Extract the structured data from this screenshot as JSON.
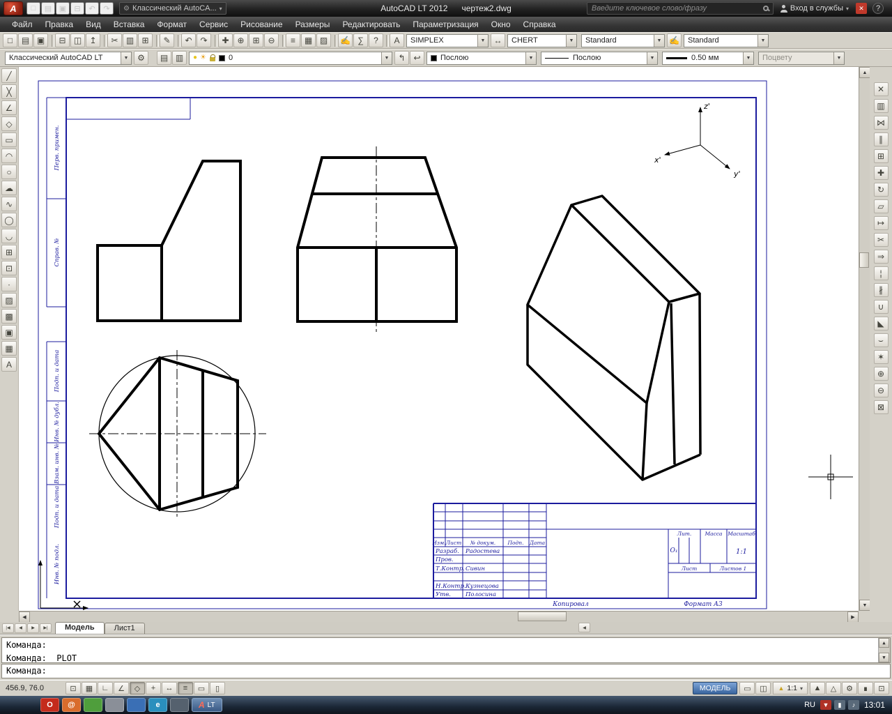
{
  "window": {
    "app_initial": "A",
    "title_app": "AutoCAD LT 2012",
    "title_doc": "чертеж2.dwg"
  },
  "colors": {
    "frame_blue": "#1b1b9e",
    "logo_red": "#a8250f",
    "model_button_blue": "#39659e",
    "drawing_black": "#000000"
  },
  "titlebar": {
    "workspace_combo": "Классический AutoCA...",
    "search_placeholder": "Введите ключевое слово/фразу",
    "signin_label": "Вход в службы",
    "help_label": "?"
  },
  "qat_icons": [
    {
      "name": "qat-new-icon",
      "glyph": "□"
    },
    {
      "name": "qat-open-icon",
      "glyph": "▤"
    },
    {
      "name": "qat-save-icon",
      "glyph": "▣"
    },
    {
      "name": "qat-plot-icon",
      "glyph": "⊟"
    },
    {
      "name": "qat-undo-icon",
      "glyph": "↶"
    },
    {
      "name": "qat-redo-icon",
      "glyph": "↷"
    }
  ],
  "menubar": {
    "items": [
      "Файл",
      "Правка",
      "Вид",
      "Вставка",
      "Формат",
      "Сервис",
      "Рисование",
      "Размеры",
      "Редактировать",
      "Параметризация",
      "Окно",
      "Справка"
    ]
  },
  "toolbar1_icons": [
    {
      "name": "new-button",
      "glyph": "□"
    },
    {
      "name": "open-button",
      "glyph": "▤"
    },
    {
      "name": "save-button",
      "glyph": "▣"
    },
    {
      "name": "plot-button",
      "glyph": "⊟",
      "gap": true
    },
    {
      "name": "plot-preview-button",
      "glyph": "◫"
    },
    {
      "name": "publish-button",
      "glyph": "↥"
    },
    {
      "name": "cut-button",
      "glyph": "✂",
      "gap": true
    },
    {
      "name": "copy-button",
      "glyph": "▥"
    },
    {
      "name": "paste-button",
      "glyph": "⊞"
    },
    {
      "name": "match-properties-button",
      "glyph": "✎",
      "gap": true
    },
    {
      "name": "undo-button",
      "glyph": "↶",
      "gap": true
    },
    {
      "name": "redo-button",
      "glyph": "↷"
    },
    {
      "name": "pan-button",
      "glyph": "✚",
      "gap": true
    },
    {
      "name": "zoom-realtime-button",
      "glyph": "⊕"
    },
    {
      "name": "zoom-window-button",
      "glyph": "⊞"
    },
    {
      "name": "zoom-previous-button",
      "glyph": "⊖"
    },
    {
      "name": "properties-button",
      "glyph": "≡",
      "gap": true
    },
    {
      "name": "designcenter-button",
      "glyph": "▦"
    },
    {
      "name": "tool-palettes-button",
      "glyph": "▨"
    },
    {
      "name": "markup-button",
      "glyph": "✍",
      "gap": true
    },
    {
      "name": "calculator-button",
      "glyph": "∑"
    },
    {
      "name": "help-toolbar-button",
      "glyph": "?"
    }
  ],
  "style_icons": {
    "text": "A",
    "dim": "↔",
    "mleader": "✍"
  },
  "styles": {
    "text_style": "SIMPLEX",
    "dim_style": "CHERT",
    "table_style": "Standard",
    "mleader_style": "Standard"
  },
  "workspace_bar": {
    "workspace": "Классический AutoCAD LT",
    "gear": "⚙",
    "layer": "0",
    "color": "Послою",
    "linetype": "Послою",
    "lineweight": "0.50 мм",
    "plot_style": "Поцвету"
  },
  "layer_combo": {
    "bulb": "●",
    "sun": "☀"
  },
  "layer_icons": [
    {
      "name": "layer-properties-button",
      "glyph": "▤"
    },
    {
      "name": "layer-states-button",
      "glyph": "▥"
    }
  ],
  "layer_actions": [
    {
      "name": "make-object-layer-current-button",
      "glyph": "↰"
    },
    {
      "name": "layer-previous-button",
      "glyph": "↩"
    }
  ],
  "draw_icons": [
    {
      "name": "line-button",
      "glyph": "╱"
    },
    {
      "name": "construction-line-button",
      "glyph": "╳"
    },
    {
      "name": "polyline-button",
      "glyph": "∠"
    },
    {
      "name": "polygon-button",
      "glyph": "◇"
    },
    {
      "name": "rectangle-button",
      "glyph": "▭"
    },
    {
      "name": "arc-button",
      "glyph": "◠"
    },
    {
      "name": "circle-button",
      "glyph": "○"
    },
    {
      "name": "revision-cloud-button",
      "glyph": "☁"
    },
    {
      "name": "spline-button",
      "glyph": "∿"
    },
    {
      "name": "ellipse-button",
      "glyph": "◯"
    },
    {
      "name": "ellipse-arc-button",
      "glyph": "◡"
    },
    {
      "name": "insert-block-button",
      "glyph": "⊞"
    },
    {
      "name": "make-block-button",
      "glyph": "⊡"
    },
    {
      "name": "point-button",
      "glyph": "∙"
    },
    {
      "name": "hatch-button",
      "glyph": "▨"
    },
    {
      "name": "gradient-button",
      "glyph": "▩"
    },
    {
      "name": "region-button",
      "glyph": "▣"
    },
    {
      "name": "table-button",
      "glyph": "▦"
    },
    {
      "name": "multiline-text-button",
      "glyph": "A"
    }
  ],
  "modify_icons": [
    {
      "name": "erase-button",
      "glyph": "✕"
    },
    {
      "name": "copy-object-button",
      "glyph": "▥"
    },
    {
      "name": "mirror-button",
      "glyph": "⋈"
    },
    {
      "name": "offset-button",
      "glyph": "∥"
    },
    {
      "name": "array-button",
      "glyph": "⊞"
    },
    {
      "name": "move-button",
      "glyph": "✚"
    },
    {
      "name": "rotate-button",
      "glyph": "↻"
    },
    {
      "name": "scale-button",
      "glyph": "▱"
    },
    {
      "name": "stretch-button",
      "glyph": "↦"
    },
    {
      "name": "trim-button",
      "glyph": "✂"
    },
    {
      "name": "extend-button",
      "glyph": "⇒"
    },
    {
      "name": "break-at-point-button",
      "glyph": "¦"
    },
    {
      "name": "break-button",
      "glyph": "∦"
    },
    {
      "name": "join-button",
      "glyph": "∪"
    },
    {
      "name": "chamfer-button",
      "glyph": "◣"
    },
    {
      "name": "fillet-button",
      "glyph": "⌣"
    },
    {
      "name": "explode-button",
      "glyph": "✶"
    },
    {
      "name": "zoom-in-button",
      "glyph": "⊕"
    },
    {
      "name": "zoom-out-button",
      "glyph": "⊖"
    },
    {
      "name": "zoom-extents-button",
      "glyph": "⊠"
    }
  ],
  "scroll": {
    "up": "▲",
    "down": "▼",
    "left": "◀",
    "right": "▶"
  },
  "tabs": {
    "nav": [
      {
        "name": "first-tab-button",
        "glyph": "|◀"
      },
      {
        "name": "prev-tab-button",
        "glyph": "◀"
      },
      {
        "name": "next-tab-button",
        "glyph": "▶"
      },
      {
        "name": "last-tab-button",
        "glyph": "▶|"
      }
    ],
    "model": "Модель",
    "layout1": "Лист1",
    "scroll_left": "◀"
  },
  "command": {
    "line1": "Команда:",
    "line2": "Команда: _PLOT",
    "prompt": "Команда:"
  },
  "status_toggles": [
    {
      "name": "snap-toggle",
      "glyph": "⊡"
    },
    {
      "name": "grid-toggle",
      "glyph": "▦"
    },
    {
      "name": "ortho-toggle",
      "glyph": "∟"
    },
    {
      "name": "polar-toggle",
      "glyph": "∠"
    },
    {
      "name": "osnap-toggle",
      "glyph": "◇",
      "pressed": true
    },
    {
      "name": "otrack-toggle",
      "glyph": "+"
    },
    {
      "name": "dyn-toggle",
      "glyph": "↔"
    },
    {
      "name": "lwt-toggle",
      "glyph": "≡",
      "pressed": true
    },
    {
      "name": "qp-toggle",
      "glyph": "▭"
    },
    {
      "name": "properties-toggle",
      "glyph": "▯"
    }
  ],
  "statusbar": {
    "coords": "456.9, 76.0",
    "model": "МОДЕЛЬ",
    "scale": "1:1",
    "right_icons": [
      {
        "name": "quick-view-layouts-button",
        "glyph": "▭"
      },
      {
        "name": "quick-view-drawings-button",
        "glyph": "◫"
      }
    ],
    "right_icons2": [
      {
        "name": "annotation-visibility-button",
        "glyph": "▲"
      },
      {
        "name": "annotation-autoscale-button",
        "glyph": "△"
      },
      {
        "name": "workspace-settings-button",
        "glyph": "⚙"
      },
      {
        "name": "toolbar-lock-button",
        "glyph": "∎"
      },
      {
        "name": "clean-screen-button",
        "glyph": "⊡"
      }
    ]
  },
  "taskbar": {
    "items": [
      {
        "name": "opera-taskbar-item",
        "glyph": "O",
        "color": "#c42b1c"
      },
      {
        "name": "mail-taskbar-item",
        "glyph": "@",
        "color": "#d96c2c"
      },
      {
        "name": "suse-taskbar-item",
        "glyph": "",
        "color": "#4f9e3c"
      },
      {
        "name": "files-taskbar-item",
        "glyph": "",
        "color": "#8a8f98"
      },
      {
        "name": "save-taskbar-item",
        "glyph": "",
        "color": "#3a6fb5"
      },
      {
        "name": "browser-taskbar-item",
        "glyph": "e",
        "color": "#2a8fbd"
      },
      {
        "name": "media-taskbar-item",
        "glyph": "",
        "color": "#55616e"
      }
    ],
    "autocad": {
      "a": "A",
      "lt": "LT"
    },
    "tray_icons": [
      {
        "name": "updates-tray-icon",
        "glyph": "▼",
        "color": "#b03226"
      },
      {
        "name": "network-tray-icon",
        "glyph": "▮",
        "color": "#5a6a7a"
      },
      {
        "name": "volume-tray-icon",
        "glyph": "♪",
        "color": "#5a6a7a"
      }
    ],
    "lang": "RU",
    "time": "13:01"
  },
  "drawing": {
    "margin_labels": [
      "Перв. примен.",
      "Справ. №",
      "Подп. и дата",
      "Инв. № дубл.",
      "Взам. инв. №",
      "Подп. и дата",
      "Инв. № подл."
    ],
    "stamp": {
      "header": [
        "Изм.",
        "Лист",
        "№ докум.",
        "Подп.",
        "Дата"
      ],
      "rows": [
        {
          "label": "Разраб.",
          "value": "Радостева"
        },
        {
          "label": "Пров.",
          "value": ""
        },
        {
          "label": "Т.Контр.",
          "value": "Сивин"
        },
        {
          "label": "Н.Контр.",
          "value": "Кузнецова"
        },
        {
          "label": "Утв.",
          "value": "Полосина"
        }
      ],
      "lit_label": "Лит.",
      "mass_label": "Масса",
      "scale_label": "Масштаб",
      "lit_value": "О₁",
      "scale_value": "1:1",
      "sheet_label": "Лист",
      "sheets_label": "Листов 1",
      "copy_label": "Копировал",
      "format_label": "Формат А3"
    },
    "axes": {
      "x": "x'",
      "y": "y'",
      "z": "z'"
    }
  }
}
